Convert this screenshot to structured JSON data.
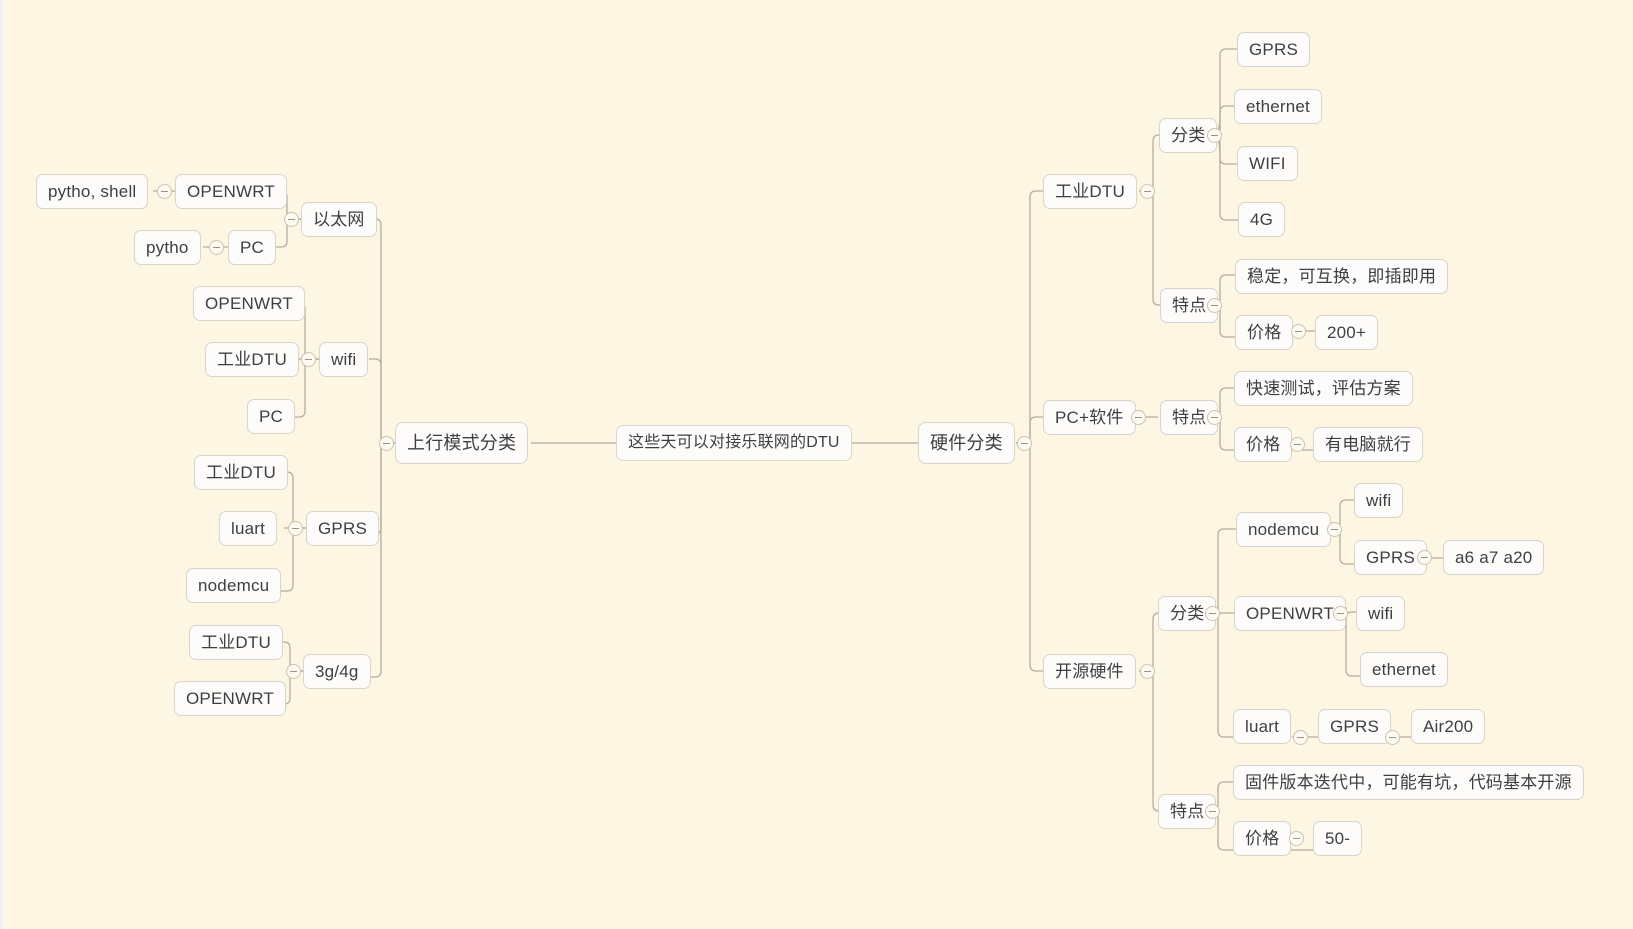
{
  "diagram": {
    "type": "mind-map",
    "title": "这些天可以对接乐联网的DTU",
    "background_color": "#fdf6e3",
    "node_fill": "#fdfcfa",
    "node_border": "#d8d4cb",
    "edge_color": "#b4ada0",
    "text_color": "#3f3f3f"
  },
  "center": {
    "label": "这些天可以对接乐联网的DTU"
  },
  "left_root": {
    "label": "上行模式分类"
  },
  "right_root": {
    "label": "硬件分类"
  },
  "left_branches": [
    {
      "label": "以太网",
      "children": [
        {
          "label": "OPENWRT",
          "children": [
            {
              "label": "pytho, shell"
            }
          ]
        },
        {
          "label": "PC",
          "children": [
            {
              "label": "pytho"
            }
          ]
        }
      ]
    },
    {
      "label": "wifi",
      "children": [
        {
          "label": "OPENWRT"
        },
        {
          "label": "工业DTU"
        },
        {
          "label": "PC"
        }
      ]
    },
    {
      "label": "GPRS",
      "children": [
        {
          "label": "工业DTU"
        },
        {
          "label": "luart"
        },
        {
          "label": "nodemcu"
        }
      ]
    },
    {
      "label": "3g/4g",
      "children": [
        {
          "label": "工业DTU"
        },
        {
          "label": "OPENWRT"
        }
      ]
    }
  ],
  "right_branches": [
    {
      "label": "工业DTU",
      "children": [
        {
          "label": "分类",
          "children": [
            {
              "label": "GPRS"
            },
            {
              "label": "ethernet"
            },
            {
              "label": "WIFI"
            },
            {
              "label": "4G"
            }
          ]
        },
        {
          "label": "特点",
          "children": [
            {
              "label": "稳定，可互换，即插即用"
            },
            {
              "label": "价格",
              "children": [
                {
                  "label": "200+"
                }
              ]
            }
          ]
        }
      ]
    },
    {
      "label": "PC+软件",
      "children": [
        {
          "label": "特点",
          "children": [
            {
              "label": "快速测试，评估方案"
            },
            {
              "label": "价格",
              "children": [
                {
                  "label": "有电脑就行"
                }
              ]
            }
          ]
        }
      ]
    },
    {
      "label": "开源硬件",
      "children": [
        {
          "label": "分类",
          "children": [
            {
              "label": "nodemcu",
              "children": [
                {
                  "label": "wifi"
                },
                {
                  "label": "GPRS",
                  "children": [
                    {
                      "label": "a6 a7 a20"
                    }
                  ]
                }
              ]
            },
            {
              "label": "OPENWRT",
              "children": [
                {
                  "label": "wifi"
                },
                {
                  "label": "ethernet"
                }
              ]
            },
            {
              "label": "luart",
              "children": [
                {
                  "label": "GPRS",
                  "children": [
                    {
                      "label": "Air200"
                    }
                  ]
                }
              ]
            }
          ]
        },
        {
          "label": "特点",
          "children": [
            {
              "label": "固件版本迭代中，可能有坑，代码基本开源"
            },
            {
              "label": "价格",
              "children": [
                {
                  "label": "50-"
                }
              ]
            }
          ]
        }
      ]
    }
  ],
  "nodes": {
    "n_center": {
      "label": "这些天可以对接乐联网的DTU"
    },
    "n_left_root": {
      "label": "上行模式分类"
    },
    "n_right_root": {
      "label": "硬件分类"
    },
    "n_l_ethernet": {
      "label": "以太网"
    },
    "n_l_openwrt1": {
      "label": "OPENWRT"
    },
    "n_l_pythoshell": {
      "label": "pytho, shell"
    },
    "n_l_pc1": {
      "label": "PC"
    },
    "n_l_pytho": {
      "label": "pytho"
    },
    "n_l_wifi": {
      "label": "wifi"
    },
    "n_l_openwrt2": {
      "label": "OPENWRT"
    },
    "n_l_dtu1": {
      "label": "工业DTU"
    },
    "n_l_pc2": {
      "label": "PC"
    },
    "n_l_gprs": {
      "label": "GPRS"
    },
    "n_l_dtu2": {
      "label": "工业DTU"
    },
    "n_l_luart": {
      "label": "luart"
    },
    "n_l_nodemcu": {
      "label": "nodemcu"
    },
    "n_l_3g4g": {
      "label": "3g/4g"
    },
    "n_l_dtu3": {
      "label": "工业DTU"
    },
    "n_l_openwrt3": {
      "label": "OPENWRT"
    },
    "n_r_dtu": {
      "label": "工业DTU"
    },
    "n_r_fenlei1": {
      "label": "分类"
    },
    "n_r_gprs1": {
      "label": "GPRS"
    },
    "n_r_ethernet1": {
      "label": "ethernet"
    },
    "n_r_wifi1": {
      "label": "WIFI"
    },
    "n_r_4g": {
      "label": "4G"
    },
    "n_r_tedian1": {
      "label": "特点"
    },
    "n_r_stable": {
      "label": "稳定，可互换，即插即用"
    },
    "n_r_price1": {
      "label": "价格"
    },
    "n_r_price1v": {
      "label": "200+"
    },
    "n_r_pcsoft": {
      "label": "PC+软件"
    },
    "n_r_tedian2": {
      "label": "特点"
    },
    "n_r_fasttest": {
      "label": "快速测试，评估方案"
    },
    "n_r_price2": {
      "label": "价格"
    },
    "n_r_price2v": {
      "label": "有电脑就行"
    },
    "n_r_open": {
      "label": "开源硬件"
    },
    "n_r_fenlei2": {
      "label": "分类"
    },
    "n_r_nodemcu": {
      "label": "nodemcu"
    },
    "n_r_nwifi": {
      "label": "wifi"
    },
    "n_r_ngprs": {
      "label": "GPRS"
    },
    "n_r_a6": {
      "label": "a6 a7 a20"
    },
    "n_r_openwrt": {
      "label": "OPENWRT"
    },
    "n_r_owifi": {
      "label": "wifi"
    },
    "n_r_oeth": {
      "label": "ethernet"
    },
    "n_r_luart": {
      "label": "luart"
    },
    "n_r_lgprs": {
      "label": "GPRS"
    },
    "n_r_air200": {
      "label": "Air200"
    },
    "n_r_tedian3": {
      "label": "特点"
    },
    "n_r_firmware": {
      "label": "固件版本迭代中，可能有坑，代码基本开源"
    },
    "n_r_price3": {
      "label": "价格"
    },
    "n_r_price3v": {
      "label": "50-"
    }
  }
}
